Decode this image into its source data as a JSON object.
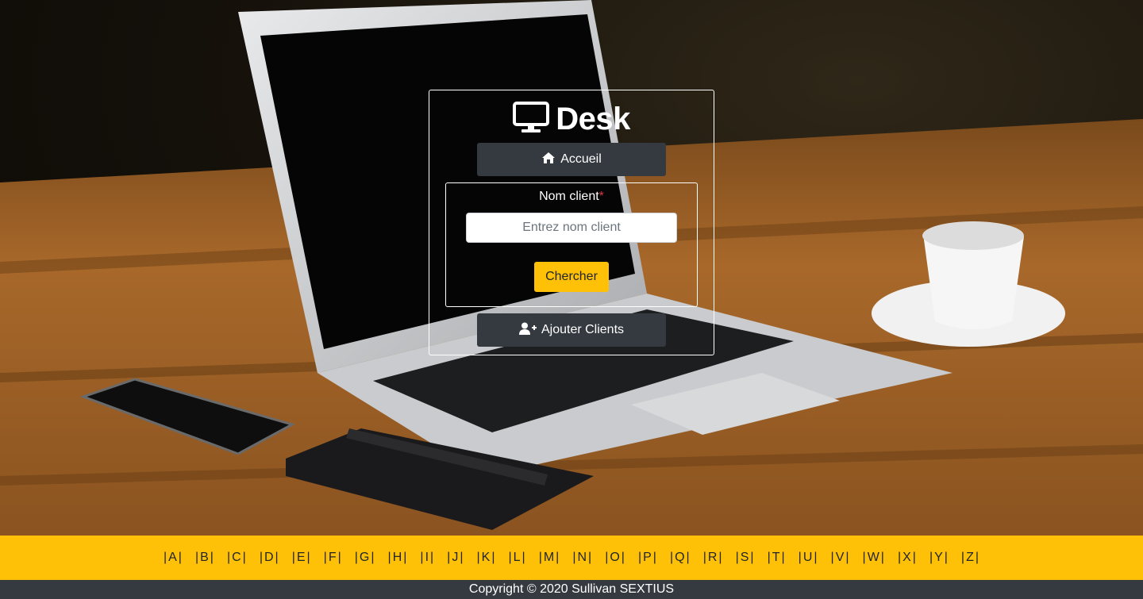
{
  "brand": {
    "title": "Desk",
    "icon": "desktop-icon"
  },
  "nav": {
    "home_label": "Accueil",
    "home_icon": "home-icon"
  },
  "search": {
    "label": "Nom client",
    "required_mark": "*",
    "placeholder": "Entrez nom client",
    "value": "",
    "button_label": "Chercher"
  },
  "add_client": {
    "label": "Ajouter Clients",
    "icon": "user-plus-icon"
  },
  "alphabet": [
    "|A|",
    "|B|",
    "|C|",
    "|D|",
    "|E|",
    "|F|",
    "|G|",
    "|H|",
    "|I|",
    "|J|",
    "|K|",
    "|L|",
    "|M|",
    "|N|",
    "|O|",
    "|P|",
    "|Q|",
    "|R|",
    "|S|",
    "|T|",
    "|U|",
    "|V|",
    "|W|",
    "|X|",
    "|Y|",
    "|Z|"
  ],
  "footer": {
    "text": "Copyright © 2020 Sullivan SEXTIUS"
  },
  "colors": {
    "accent": "#ffc107",
    "dark": "#343a40",
    "required": "#dc3545"
  }
}
